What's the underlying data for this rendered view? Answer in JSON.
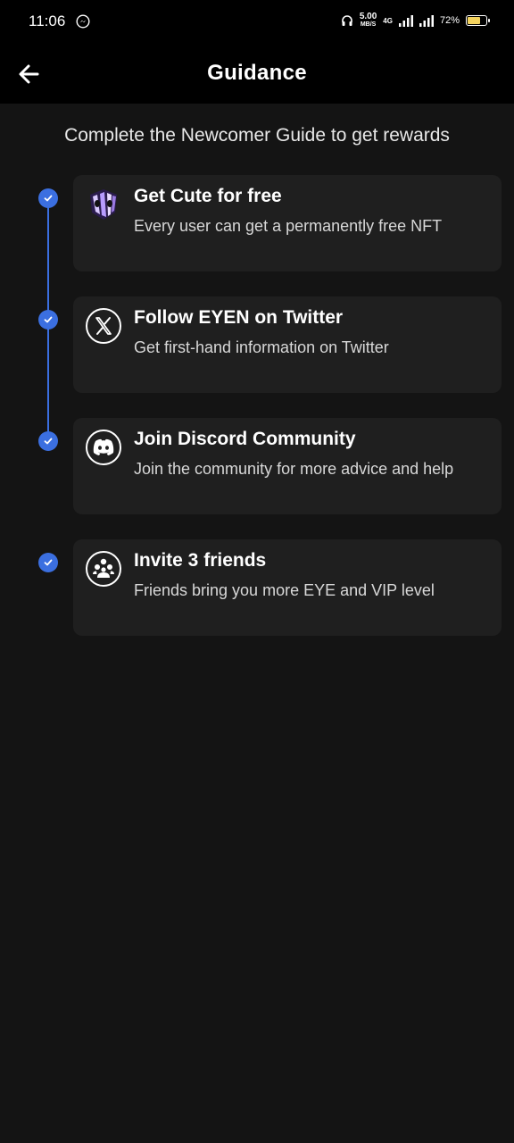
{
  "status_bar": {
    "time": "11:06",
    "net_speed_value": "5.00",
    "net_speed_unit": "MB/S",
    "network_type": "4G",
    "battery_percent": "72%",
    "battery_level": 0.72
  },
  "header": {
    "title": "Guidance"
  },
  "subtitle": "Complete the Newcomer Guide to get rewards",
  "steps": [
    {
      "title": "Get Cute for free",
      "description": "Every user can get a permanently free NFT",
      "completed": true,
      "icon": "nft-icon"
    },
    {
      "title": "Follow EYEN on Twitter",
      "description": "Get first-hand information on Twitter",
      "completed": true,
      "icon": "x-twitter-icon"
    },
    {
      "title": "Join Discord Community",
      "description": "Join the community for more advice and help",
      "completed": true,
      "icon": "discord-icon"
    },
    {
      "title": "Invite 3 friends",
      "description": "Friends bring you more EYE and VIP level",
      "completed": true,
      "icon": "friends-icon"
    }
  ],
  "colors": {
    "accent": "#3b6fe0",
    "background": "#141414",
    "card": "#1f1f1f",
    "header": "#000000"
  }
}
